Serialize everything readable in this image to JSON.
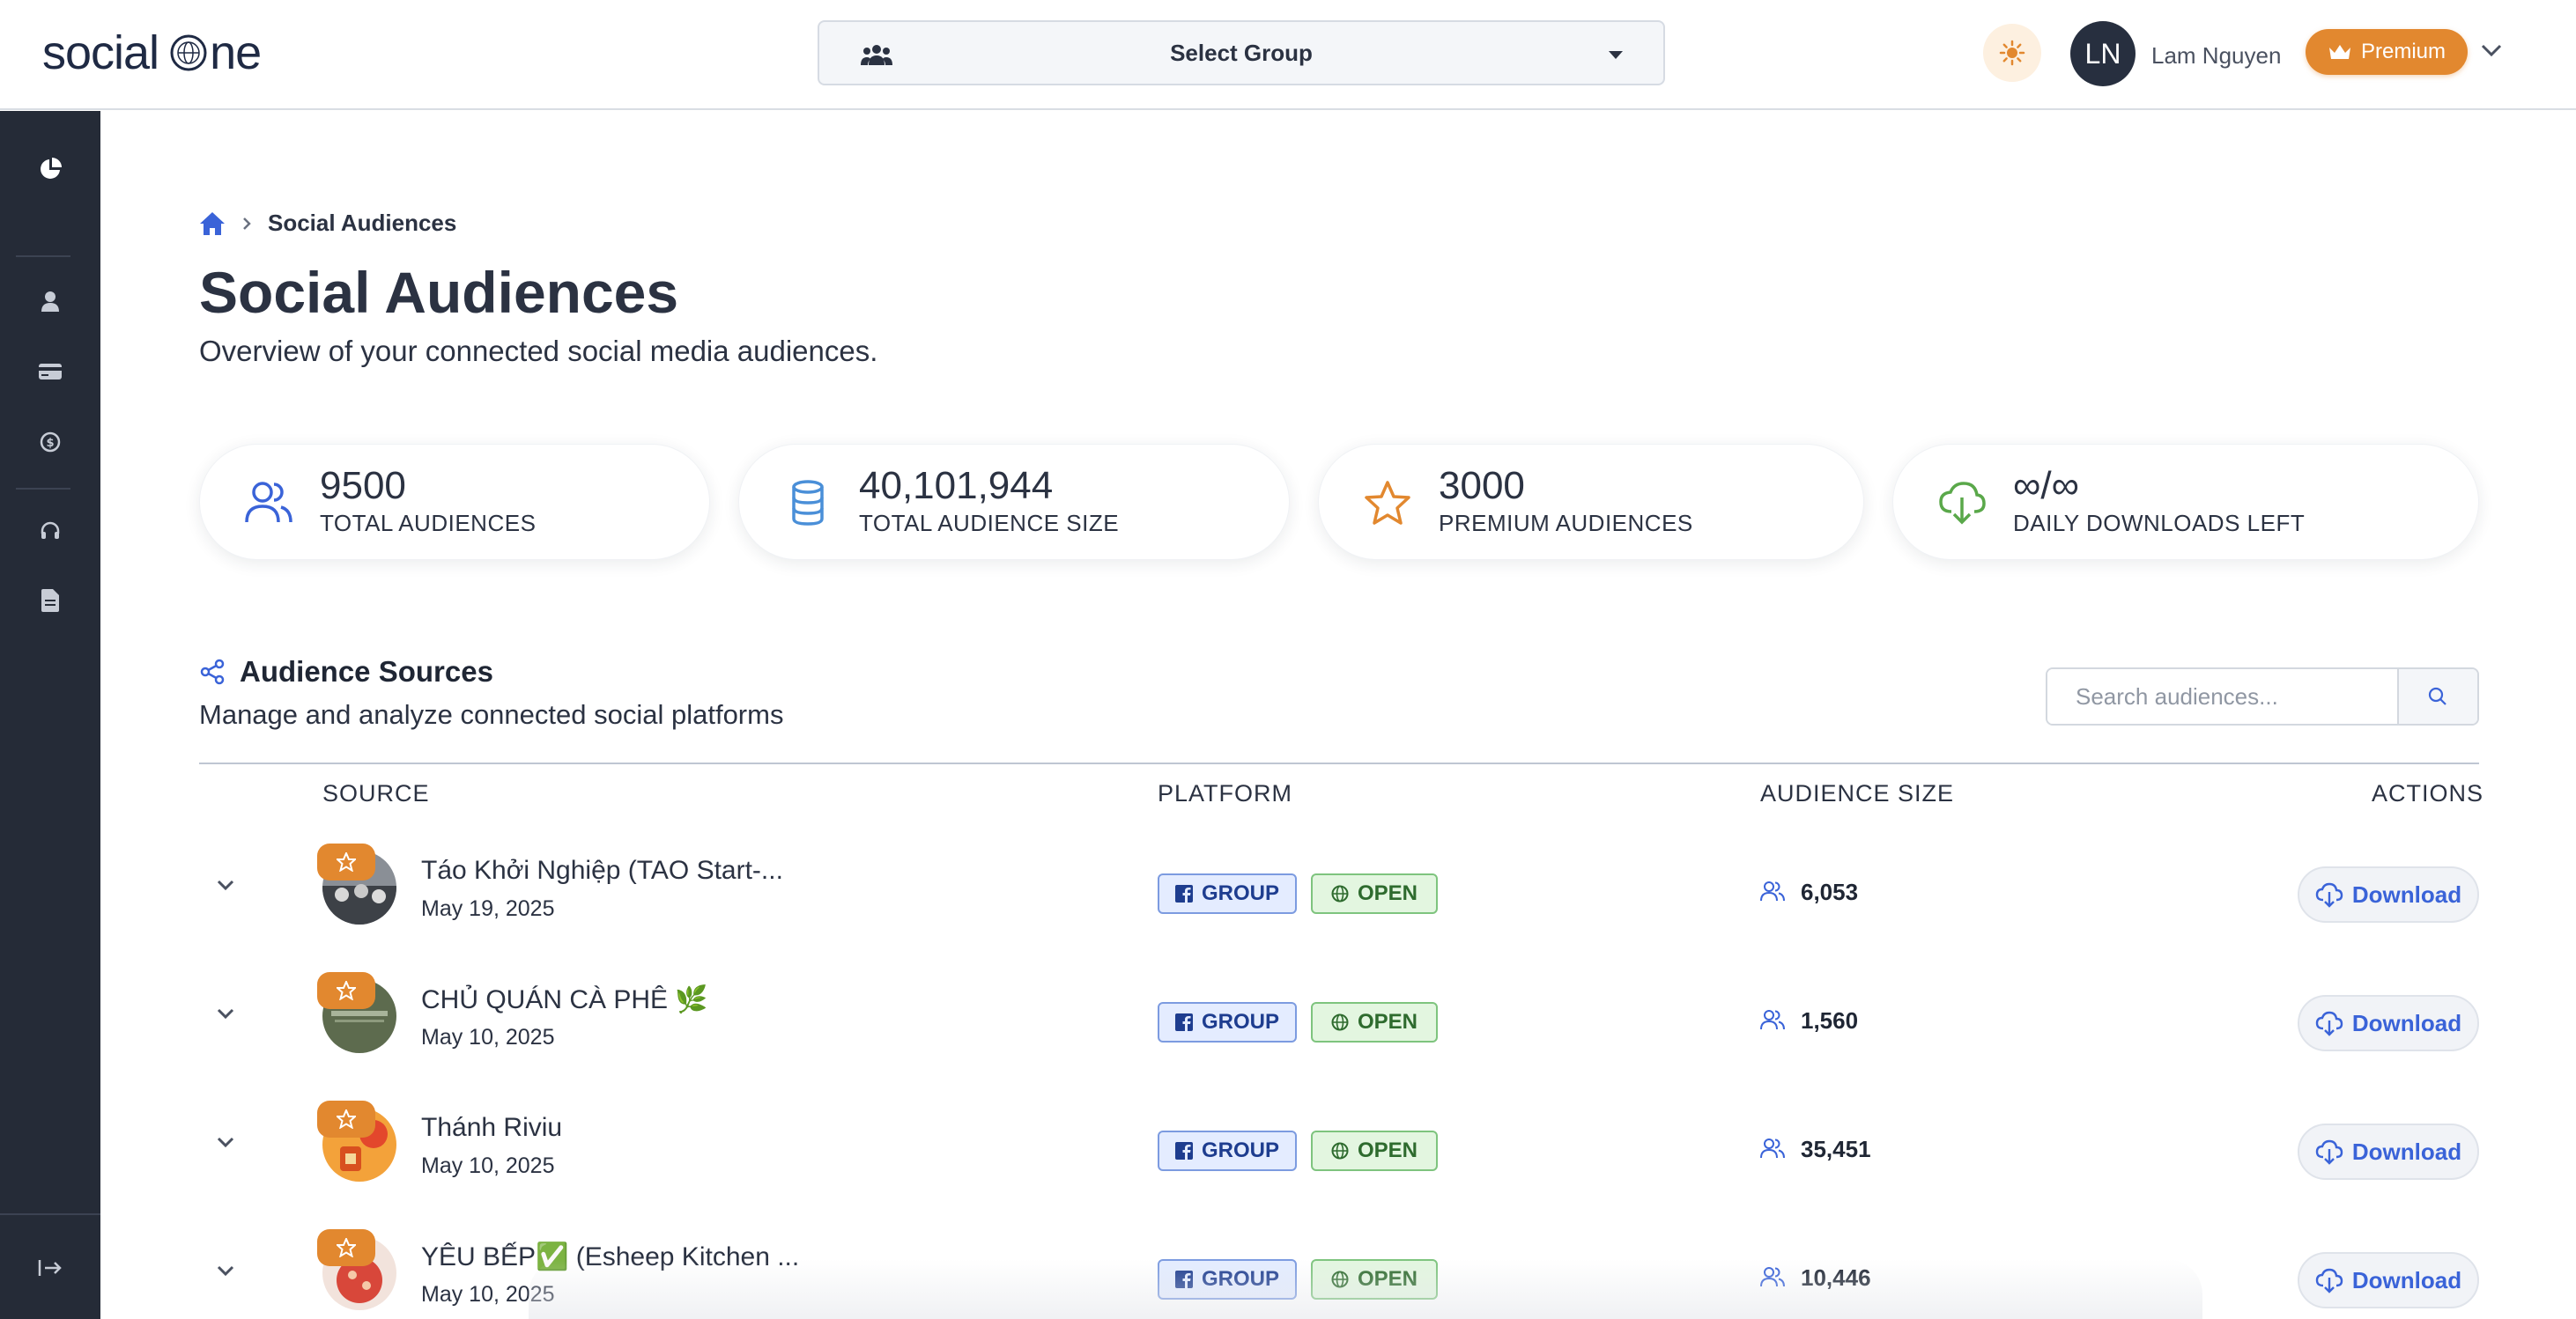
{
  "app": {
    "logo_text_left": "social",
    "logo_text_right": "ne"
  },
  "header": {
    "group_select_label": "Select Group",
    "avatar_initials": "LN",
    "user_name": "Lam Nguyen",
    "premium_label": "Premium",
    "accent_color": "#e2882f"
  },
  "breadcrumb": {
    "current": "Social Audiences"
  },
  "page": {
    "title": "Social Audiences",
    "subtitle": "Overview of your connected social media audiences."
  },
  "stats": [
    {
      "value": "9500",
      "label": "TOTAL AUDIENCES",
      "icon": "users-icon"
    },
    {
      "value": "40,101,944",
      "label": "TOTAL AUDIENCE SIZE",
      "icon": "database-icon"
    },
    {
      "value": "3000",
      "label": "PREMIUM AUDIENCES",
      "icon": "star-icon"
    },
    {
      "value": "∞/∞",
      "label": "DAILY DOWNLOADS LEFT",
      "icon": "cloud-download-icon"
    }
  ],
  "sources": {
    "title": "Audience Sources",
    "subtitle": "Manage and analyze connected social platforms",
    "search_placeholder": "Search audiences...",
    "columns": {
      "source": "SOURCE",
      "platform": "PLATFORM",
      "audience_size": "AUDIENCE SIZE",
      "actions": "ACTIONS"
    },
    "rows": [
      {
        "name": "Táo Khởi Nghiệp (TAO Start-...",
        "date": "May 19, 2025",
        "type": "GROUP",
        "privacy": "OPEN",
        "size": "6,053",
        "action": "Download"
      },
      {
        "name": "CHỦ QUÁN CÀ PHÊ 🌿",
        "date": "May 10, 2025",
        "type": "GROUP",
        "privacy": "OPEN",
        "size": "1,560",
        "action": "Download"
      },
      {
        "name": "Thánh Riviu",
        "date": "May 10, 2025",
        "type": "GROUP",
        "privacy": "OPEN",
        "size": "35,451",
        "action": "Download"
      },
      {
        "name": "YÊU BẾP✅ (Esheep Kitchen ...",
        "date": "May 10, 2025",
        "type": "GROUP",
        "privacy": "OPEN",
        "size": "10,446",
        "action": "Download"
      }
    ]
  }
}
